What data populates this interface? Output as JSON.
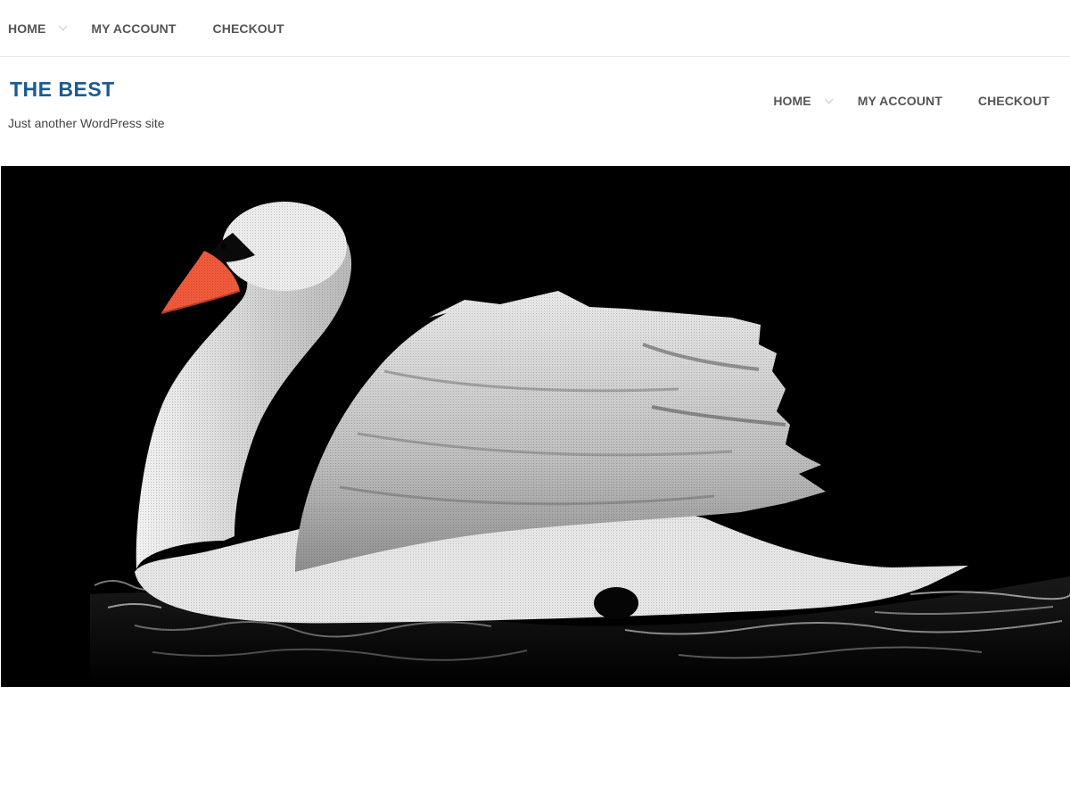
{
  "top_nav": {
    "items": [
      {
        "label": "HOME",
        "has_dropdown": true
      },
      {
        "label": "MY ACCOUNT",
        "has_dropdown": false
      },
      {
        "label": "CHECKOUT",
        "has_dropdown": false
      }
    ]
  },
  "header": {
    "site_title": "THE BEST",
    "tagline": "Just another WordPress site"
  },
  "main_nav": {
    "items": [
      {
        "label": "HOME",
        "has_dropdown": true
      },
      {
        "label": "MY ACCOUNT",
        "has_dropdown": false
      },
      {
        "label": "CHECKOUT",
        "has_dropdown": false
      }
    ]
  },
  "hero": {
    "image_subject": "white-swan-on-black-water",
    "background_color": "#000000"
  },
  "colors": {
    "site_title": "#1b5a91",
    "nav_text": "#555555",
    "tagline": "#444444",
    "divider": "#e6e6e6"
  }
}
